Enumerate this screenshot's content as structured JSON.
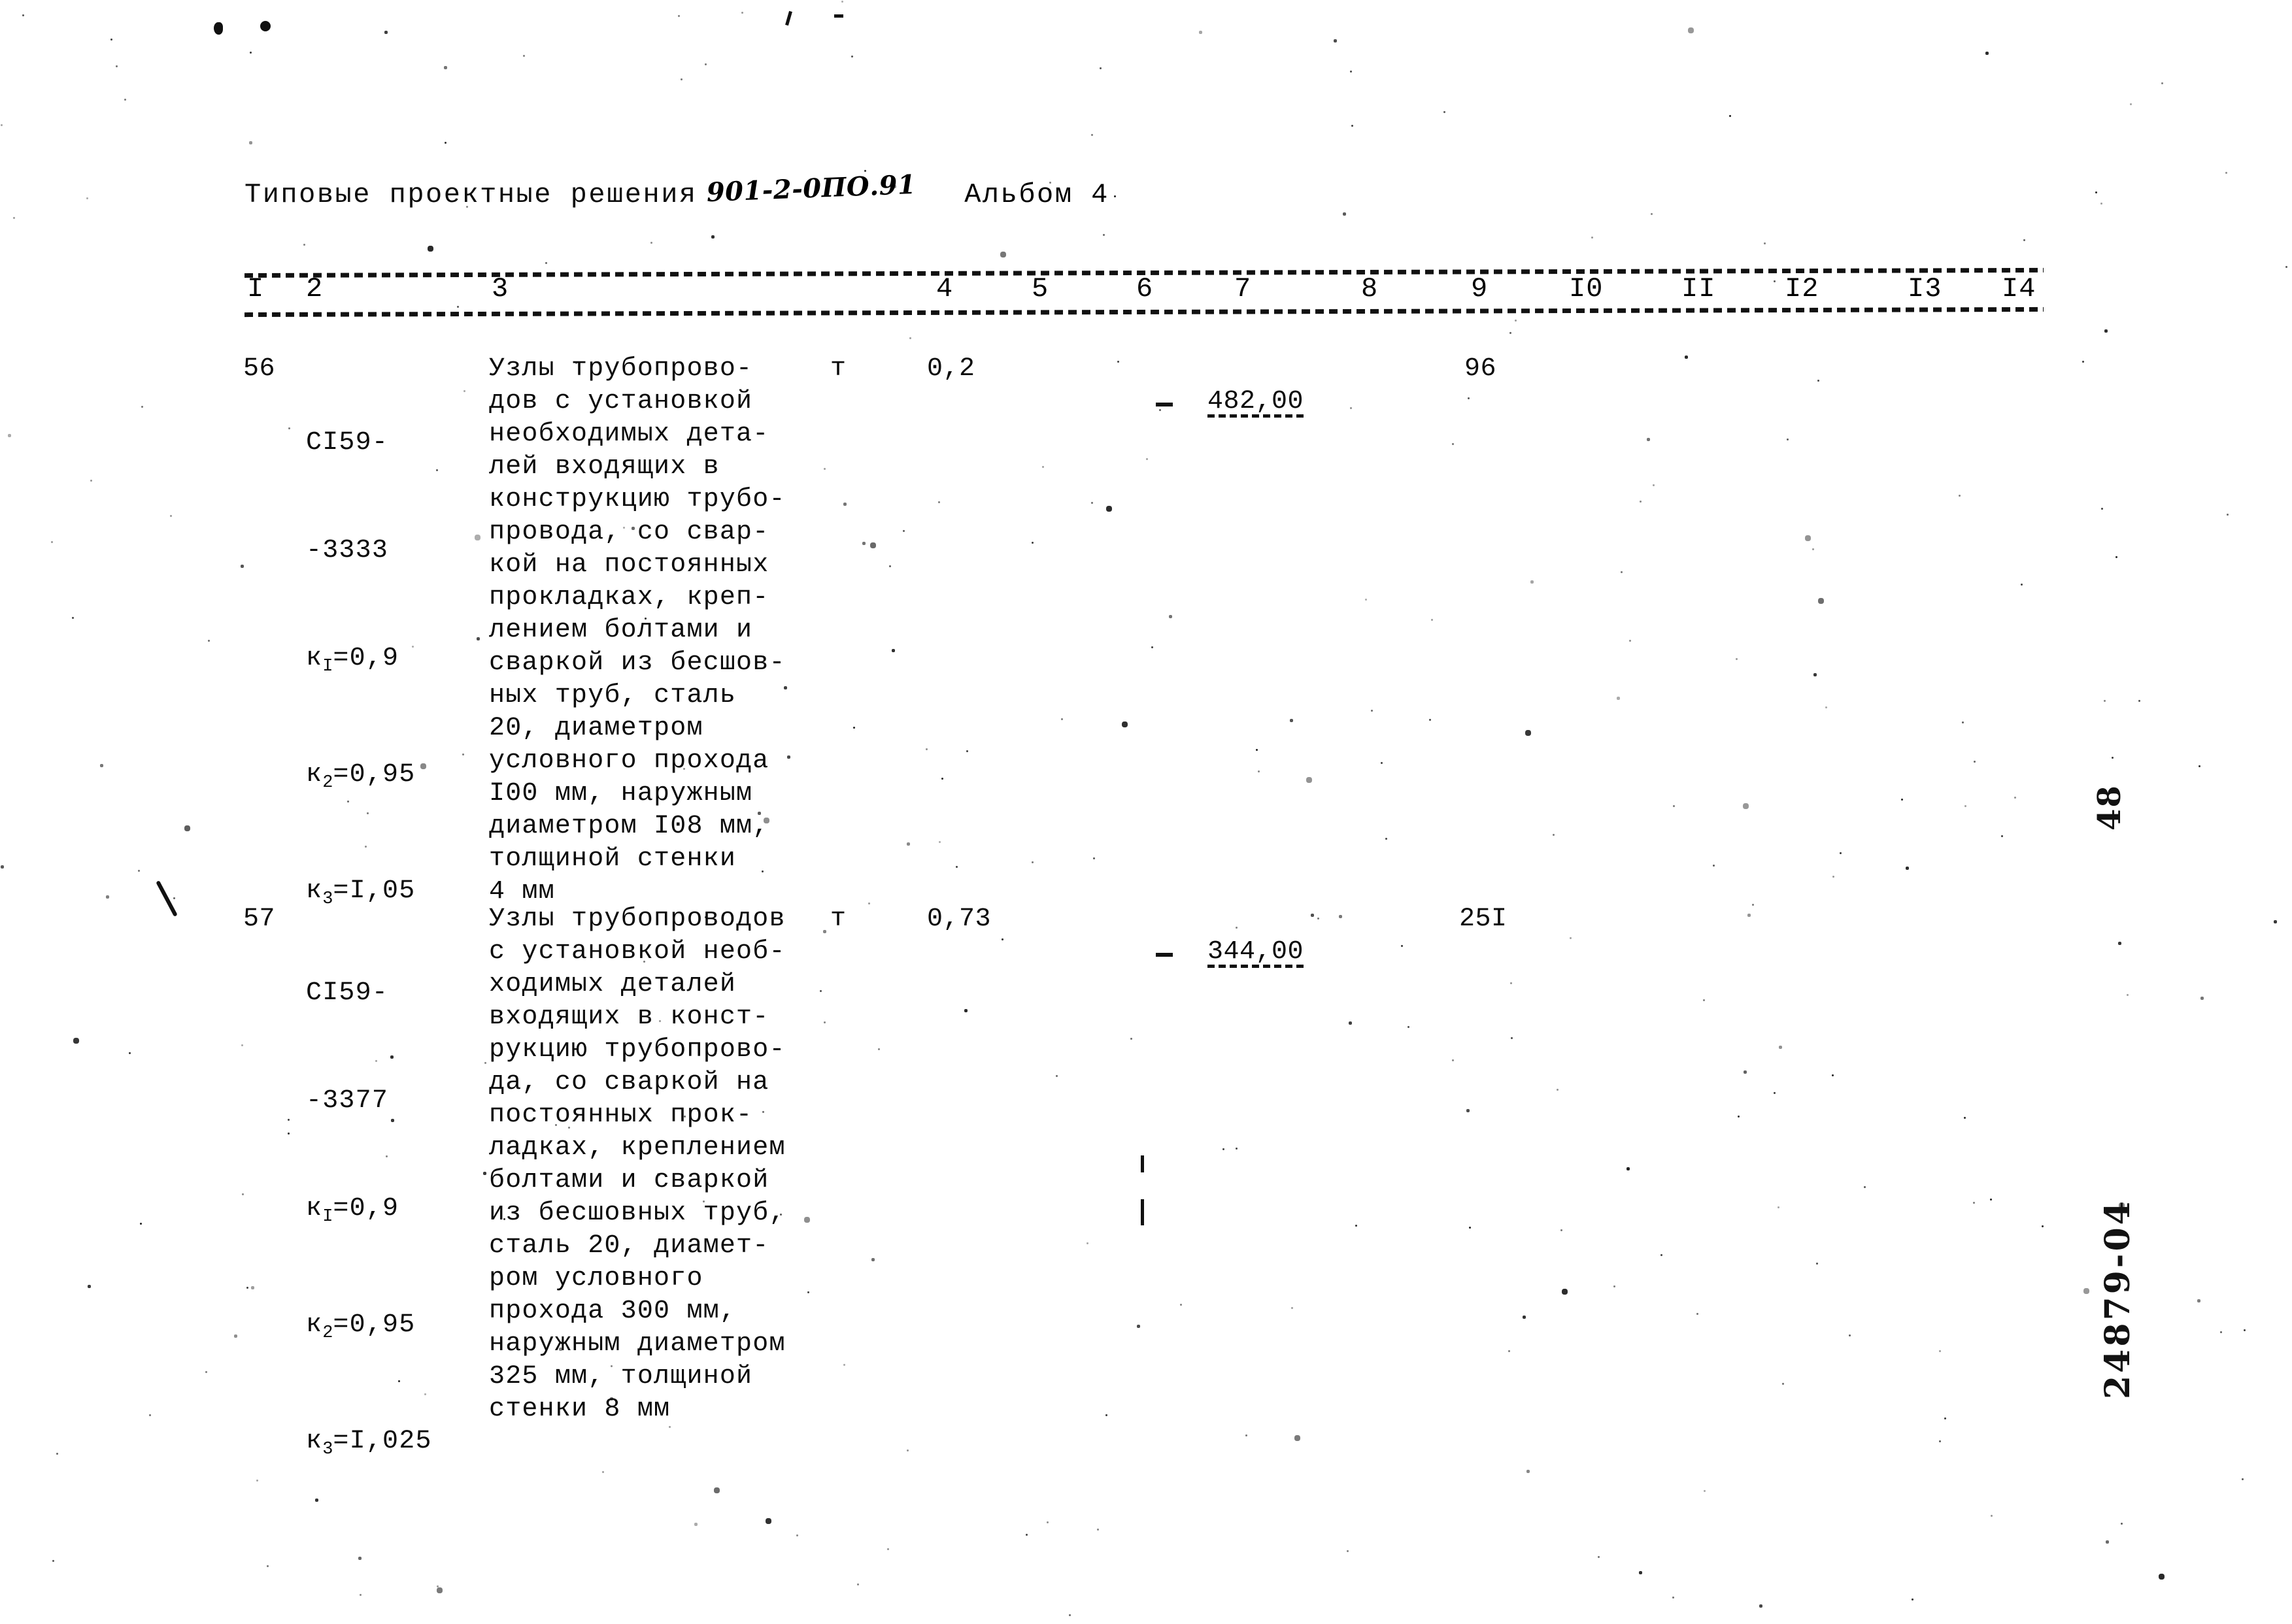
{
  "document": {
    "header": {
      "series_label": "Типовые проектные решения",
      "series_code": "901-2-0ПО.91",
      "album_label": "Альбом 4"
    },
    "margin": {
      "page_number": "48",
      "archive_code": "24879-04"
    }
  },
  "table": {
    "column_headers": [
      "I",
      "2",
      "3",
      "4",
      "5",
      "6",
      "7",
      "8",
      "9",
      "I0",
      "II",
      "I2",
      "I3",
      "I4"
    ],
    "rows": [
      {
        "number": "56",
        "code_lines": [
          "СI59-",
          "-3333"
        ],
        "coefficients": [
          {
            "symbol": "к",
            "index": "I",
            "value": "=0,9"
          },
          {
            "symbol": "к",
            "index": "2",
            "value": "=0,95"
          },
          {
            "symbol": "к",
            "index": "3",
            "value": "=I,05"
          }
        ],
        "description": "Узлы трубопрово-\nдов с установкой\nнеобходимых дета-\nлей входящих в\nконструкцию трубо-\nпровода, со свар-\nкой на постоянных\nпрокладках, креп-\nлением болтами и\nсваркой из бесшов-\nных труб, сталь\n20, диаметром\nусловного прохода\nI00 мм, наружным\nдиаметром I08 мм,\nтолщиной стенки\n4 мм",
        "unit": "т",
        "col4": "0,2",
        "col6": "482,00",
        "col9": "96"
      },
      {
        "number": "57",
        "code_lines": [
          "СI59-",
          "-3377"
        ],
        "coefficients": [
          {
            "symbol": "к",
            "index": "I",
            "value": "=0,9"
          },
          {
            "symbol": "к",
            "index": "2",
            "value": "=0,95"
          },
          {
            "symbol": "к",
            "index": "3",
            "value": "=I,025"
          }
        ],
        "description": "Узлы трубопроводов\nс установкой необ-\nходимых деталей\nвходящих в конст-\nрукцию трубопрово-\nда, со сваркой на\nпостоянных прок-\nладках, креплением\nболтами и сваркой\nиз бесшовных труб,\nсталь 20, диамет-\nром условного\nпрохода 300 мм,\nнаружным диаметром\n325 мм, толщиной\nстенки 8 мм",
        "unit": "т",
        "col4": "0,73",
        "col6": "344,00",
        "col9": "25I"
      }
    ]
  }
}
